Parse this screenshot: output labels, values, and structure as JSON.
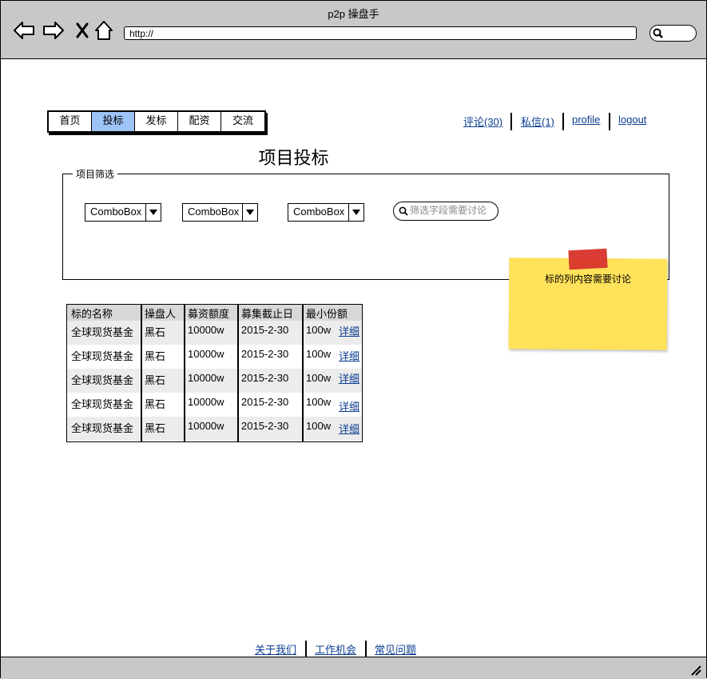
{
  "window": {
    "title": "p2p 操盘手",
    "url": "http://"
  },
  "nav_tabs": [
    {
      "label": "首页",
      "active": false
    },
    {
      "label": "投标",
      "active": true
    },
    {
      "label": "发标",
      "active": false
    },
    {
      "label": "配资",
      "active": false
    },
    {
      "label": "交流",
      "active": false
    }
  ],
  "top_links": {
    "comments": "评论(30)",
    "messages": "私信(1)",
    "profile": "profile",
    "logout": "logout"
  },
  "page_title": "项目投标",
  "filter": {
    "legend": "项目筛选",
    "combos": [
      "ComboBox",
      "ComboBox",
      "ComboBox"
    ],
    "search_placeholder": "筛选字段需要讨论"
  },
  "sticky_note": {
    "text": "标的列内容需要讨论",
    "color": "#ffe25a"
  },
  "table": {
    "headers": [
      "标的名称",
      "操盘人",
      "募资额度",
      "募集截止日",
      "最小份额"
    ],
    "rows": [
      [
        "全球现货基金",
        "黑石",
        "10000w",
        "2015-2-30",
        "100w",
        "详细"
      ],
      [
        "全球现货基金",
        "黑石",
        "10000w",
        "2015-2-30",
        "100w",
        "详细"
      ],
      [
        "全球现货基金",
        "黑石",
        "10000w",
        "2015-2-30",
        "100w",
        "详细"
      ],
      [
        "全球现货基金",
        "黑石",
        "10000w",
        "2015-2-30",
        "100w",
        "详细"
      ],
      [
        "全球现货基金",
        "黑石",
        "10000w",
        "2015-2-30",
        "100w",
        "详细"
      ]
    ]
  },
  "footer": {
    "about": "关于我们",
    "jobs": "工作机会",
    "faq": "常见问题"
  },
  "colors": {
    "active_tab": "#9ec3f7",
    "link": "#0b3d91",
    "chrome": "#c8c8c8",
    "tape": "#d8332b"
  }
}
